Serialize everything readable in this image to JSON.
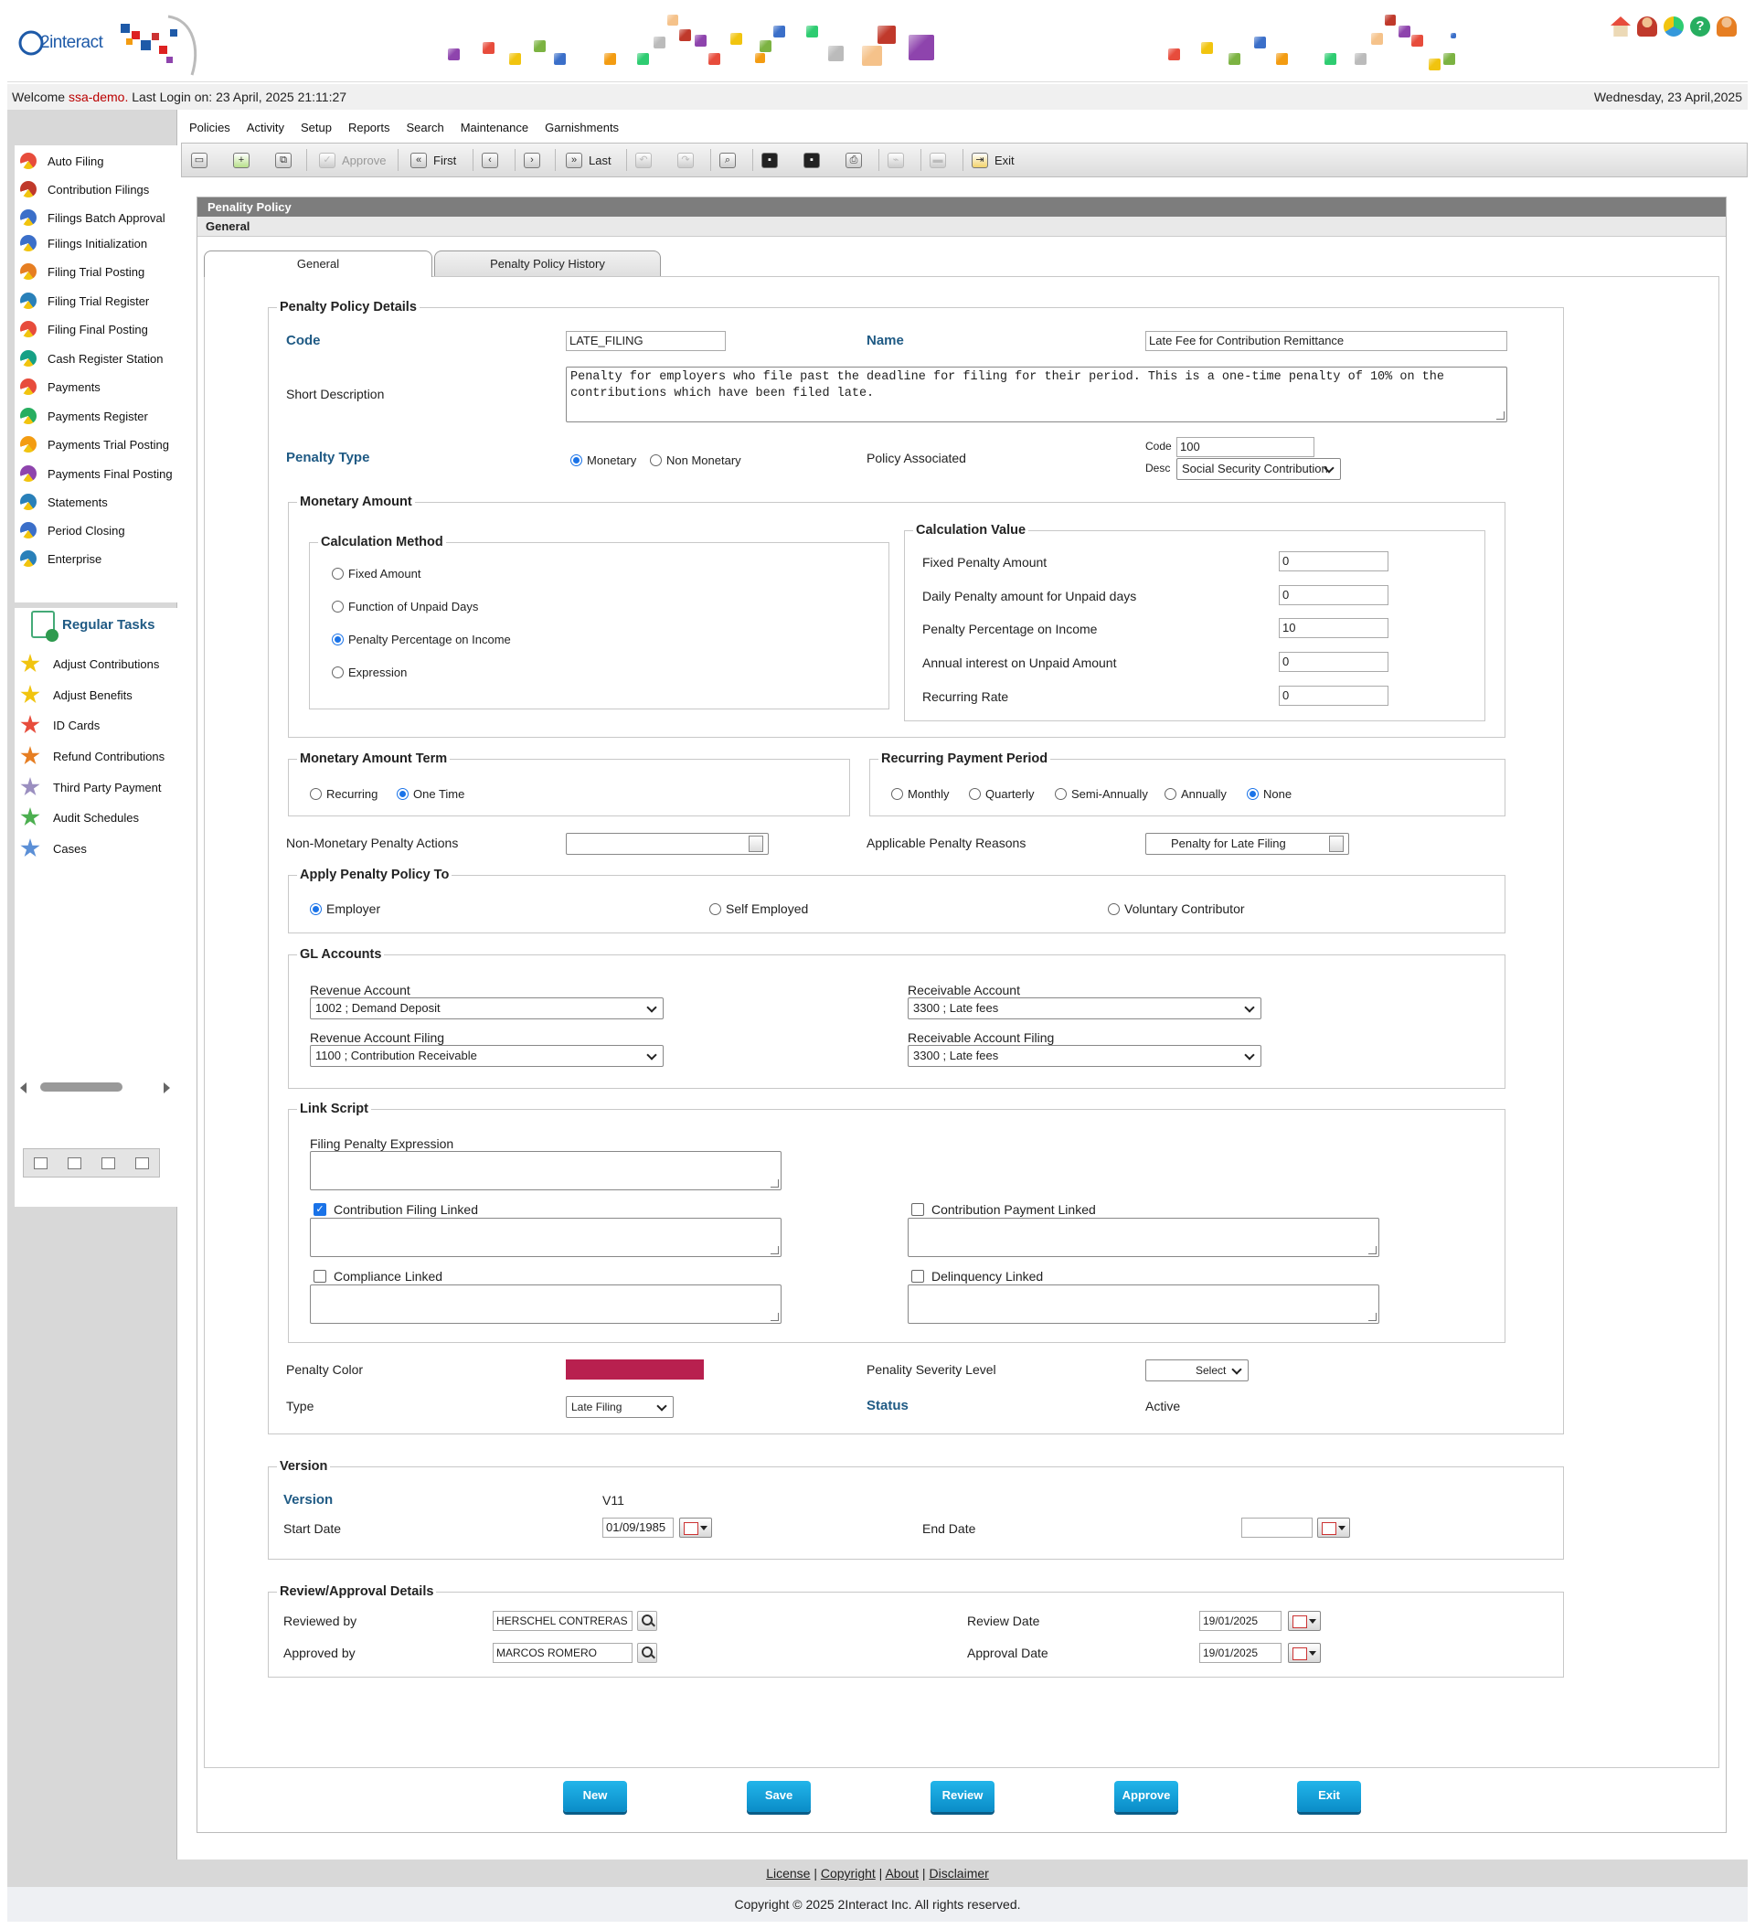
{
  "brand": {
    "name": "2interact"
  },
  "header": {
    "welcome_prefix": "Welcome",
    "user": "ssa-demo.",
    "last_login": "Last Login on: 23 April, 2025 21:11:27",
    "date": "Wednesday, 23 April,2025"
  },
  "menu": {
    "items": [
      "Policies",
      "Activity",
      "Setup",
      "Reports",
      "Search",
      "Maintenance",
      "Garnishments"
    ]
  },
  "toolbar": {
    "approve": "Approve",
    "first": "First",
    "last": "Last",
    "exit": "Exit"
  },
  "sidebar": {
    "items": [
      "Auto Filing",
      "Contribution Filings",
      "Filings Batch Approval",
      "Filings Initialization",
      "Filing Trial Posting",
      "Filing Trial Register",
      "Filing Final Posting",
      "Cash Register Station",
      "Payments",
      "Payments Register",
      "Payments Trial Posting",
      "Payments Final Posting",
      "Statements",
      "Period Closing",
      "Enterprise"
    ],
    "regular_tasks_title": "Regular Tasks",
    "tasks": [
      "Adjust Contributions",
      "Adjust Benefits",
      "ID Cards",
      "Refund Contributions",
      "Third Party Payment",
      "Audit Schedules",
      "Cases"
    ]
  },
  "panel": {
    "title": "Penality Policy",
    "subtitle": "General"
  },
  "tabs": [
    "General",
    "Penalty Policy History"
  ],
  "details": {
    "legend": "Penalty Policy Details",
    "code_label": "Code",
    "code_value": "LATE_FILING",
    "name_label": "Name",
    "name_value": "Late Fee for Contribution Remittance",
    "short_desc_label": "Short Description",
    "short_desc_value": "Penalty for employers who file past the deadline for filing for their period.  This is a one-time penalty of 10% on the contributions which have been filed late.",
    "penalty_type_label": "Penalty Type",
    "penalty_type_options": [
      "Monetary",
      "Non Monetary"
    ],
    "penalty_type_selected": "Monetary",
    "policy_assoc_label": "Policy Associated",
    "policy_code_label": "Code",
    "policy_code_value": "100",
    "policy_desc_label": "Desc",
    "policy_desc_value": "Social Security Contribution"
  },
  "monetary": {
    "legend": "Monetary Amount",
    "calc_method_legend": "Calculation Method",
    "calc_methods": [
      "Fixed Amount",
      "Function of Unpaid Days",
      "Penalty Percentage on Income",
      "Expression"
    ],
    "calc_method_selected": "Penalty Percentage on Income",
    "calc_value_legend": "Calculation Value",
    "calc_values": [
      {
        "label": "Fixed Penalty Amount",
        "value": "0"
      },
      {
        "label": "Daily Penalty amount for Unpaid days",
        "value": "0"
      },
      {
        "label": "Penalty Percentage on Income",
        "value": "10"
      },
      {
        "label": "Annual interest on Unpaid Amount",
        "value": "0"
      },
      {
        "label": "Recurring Rate",
        "value": "0"
      }
    ]
  },
  "term": {
    "legend": "Monetary Amount Term",
    "options": [
      "Recurring",
      "One Time"
    ],
    "selected": "One Time"
  },
  "recurring_period": {
    "legend": "Recurring Payment Period",
    "options": [
      "Monthly",
      "Quarterly",
      "Semi-Annually",
      "Annually",
      "None"
    ],
    "selected": "None"
  },
  "non_monetary": {
    "label": "Non-Monetary Penalty Actions",
    "value": "",
    "reasons_label": "Applicable Penalty Reasons",
    "reasons_value": "Penalty for Late Filing"
  },
  "apply_to": {
    "legend": "Apply Penalty Policy To",
    "options": [
      "Employer",
      "Self Employed",
      "Voluntary Contributor"
    ],
    "selected": "Employer"
  },
  "gl": {
    "legend": "GL Accounts",
    "revenue_label": "Revenue Account",
    "revenue_value": "1002 ; Demand Deposit",
    "receivable_label": "Receivable Account",
    "receivable_value": "3300 ; Late fees",
    "revenue_filing_label": "Revenue Account Filing",
    "revenue_filing_value": "1100 ; Contribution Receivable",
    "receivable_filing_label": "Receivable Account Filing",
    "receivable_filing_value": "3300 ; Late fees"
  },
  "link_script": {
    "legend": "Link Script",
    "filing_expr_label": "Filing Penalty Expression",
    "contrib_filing_label": "Contribution Filing Linked",
    "contrib_filing_checked": true,
    "contrib_payment_label": "Contribution Payment Linked",
    "contrib_payment_checked": false,
    "compliance_label": "Compliance Linked",
    "compliance_checked": false,
    "delinquency_label": "Delinquency Linked",
    "delinquency_checked": false
  },
  "misc": {
    "color_label": "Penalty Color",
    "color_value": "#b8204f",
    "severity_label": "Penality Severity Level",
    "severity_value": "Select",
    "type_label": "Type",
    "type_value": "Late Filing",
    "status_label": "Status",
    "status_value": "Active"
  },
  "version": {
    "legend": "Version",
    "version_label": "Version",
    "version_value": "V11",
    "start_label": "Start Date",
    "start_value": "01/09/1985",
    "end_label": "End Date",
    "end_value": ""
  },
  "review": {
    "legend": "Review/Approval Details",
    "reviewed_by_label": "Reviewed by",
    "reviewed_by_value": "HERSCHEL  CONTRERAS",
    "approved_by_label": "Approved by",
    "approved_by_value": "MARCOS  ROMERO",
    "review_date_label": "Review Date",
    "review_date_value": "19/01/2025",
    "approval_date_label": "Approval Date",
    "approval_date_value": "19/01/2025"
  },
  "actions": [
    "New",
    "Save",
    "Review",
    "Approve",
    "Exit"
  ],
  "footer": {
    "links": [
      "License",
      "Copyright",
      "About",
      "Disclaimer"
    ],
    "copyright": "Copyright © 2025 2Interact Inc. All rights reserved."
  }
}
